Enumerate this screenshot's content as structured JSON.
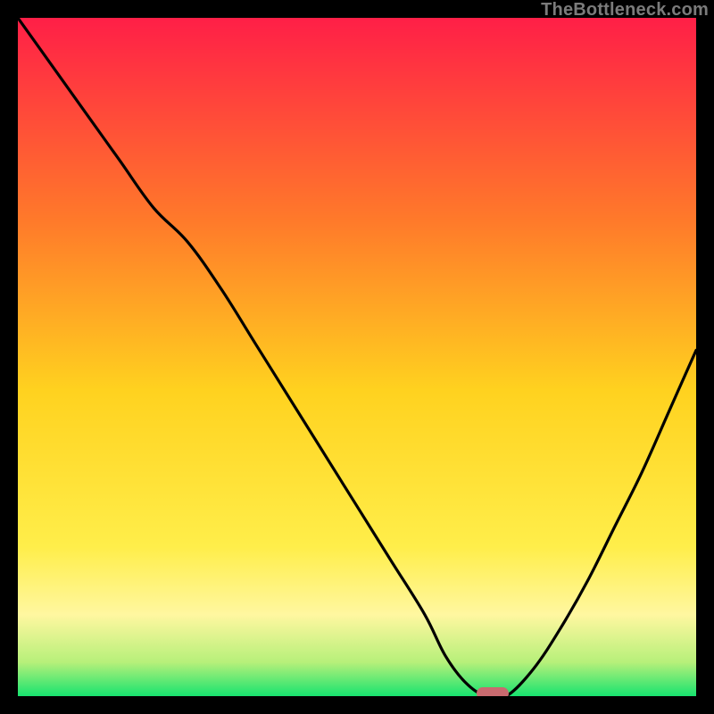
{
  "watermark": "TheBottleneck.com",
  "colors": {
    "red": "#ff1f47",
    "orange": "#ff9a1f",
    "yellow": "#ffe81f",
    "lightyellow": "#fff7a0",
    "green": "#17e36f",
    "curve": "#000000",
    "marker": "#c96a6f",
    "frame": "#000000",
    "watermark": "#7b7b7b"
  },
  "chart_data": {
    "type": "line",
    "title": "",
    "xlabel": "",
    "ylabel": "",
    "xlim": [
      0,
      100
    ],
    "ylim": [
      0,
      100
    ],
    "series": [
      {
        "name": "bottleneck-curve",
        "x": [
          0,
          5,
          10,
          15,
          20,
          25,
          30,
          35,
          40,
          45,
          50,
          55,
          60,
          63,
          66,
          69,
          72,
          76,
          80,
          84,
          88,
          92,
          96,
          100
        ],
        "y": [
          100,
          93,
          86,
          79,
          72,
          67,
          60,
          52,
          44,
          36,
          28,
          20,
          12,
          6,
          2,
          0,
          0,
          4,
          10,
          17,
          25,
          33,
          42,
          51
        ]
      }
    ],
    "marker": {
      "x": 70,
      "y": 0,
      "width": 5,
      "height": 2
    },
    "gradient_stops": [
      {
        "pos": 0.0,
        "color": "#ff1f47"
      },
      {
        "pos": 0.3,
        "color": "#ff7a2a"
      },
      {
        "pos": 0.55,
        "color": "#ffd21f"
      },
      {
        "pos": 0.78,
        "color": "#ffee4a"
      },
      {
        "pos": 0.88,
        "color": "#fff7a0"
      },
      {
        "pos": 0.95,
        "color": "#b7f07a"
      },
      {
        "pos": 1.0,
        "color": "#17e36f"
      }
    ]
  }
}
